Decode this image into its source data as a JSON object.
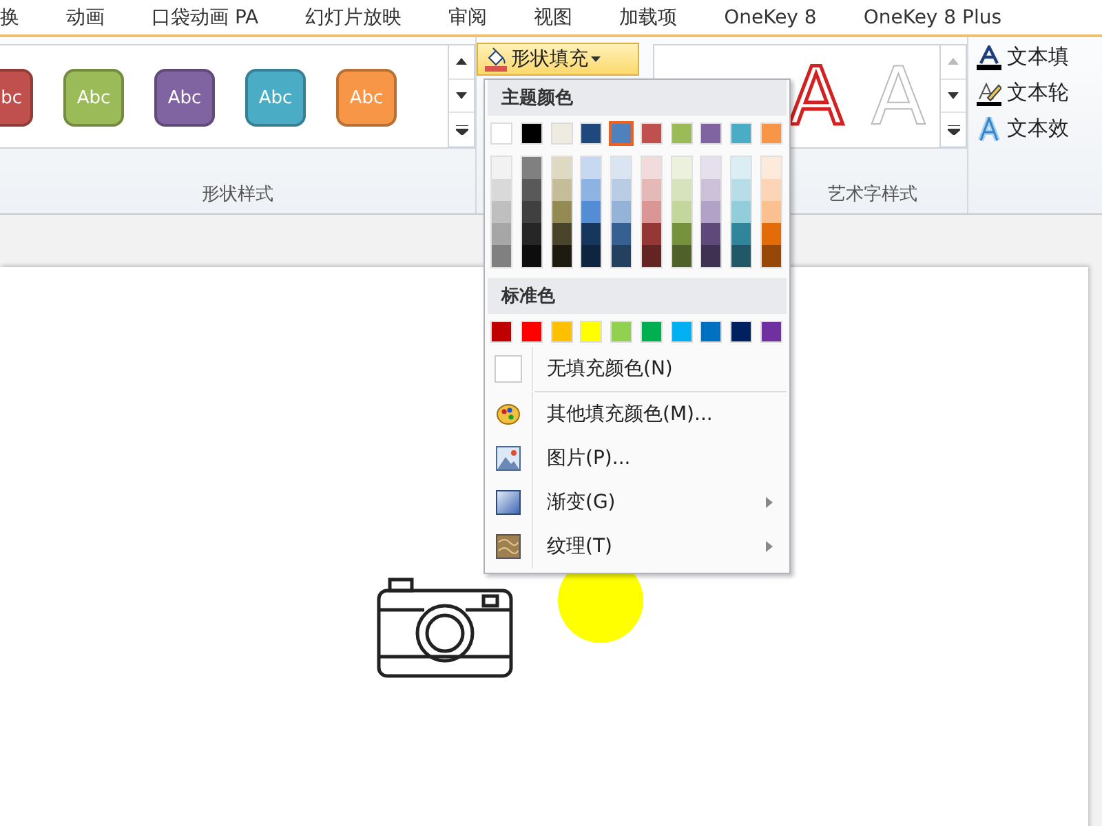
{
  "tabs": [
    {
      "label": "换",
      "selected": false
    },
    {
      "label": "动画",
      "selected": false
    },
    {
      "label": "口袋动画 PA",
      "selected": false
    },
    {
      "label": "幻灯片放映",
      "selected": false
    },
    {
      "label": "审阅",
      "selected": false
    },
    {
      "label": "视图",
      "selected": false
    },
    {
      "label": "加载项",
      "selected": false
    },
    {
      "label": "OneKey 8",
      "selected": false
    },
    {
      "label": "OneKey 8 Plus",
      "selected": false
    }
  ],
  "shape_styles": {
    "label": "形状样式",
    "swatches": [
      {
        "text": "bc",
        "color": "#c0504d"
      },
      {
        "text": "Abc",
        "color": "#9bbb59"
      },
      {
        "text": "Abc",
        "color": "#8064a2"
      },
      {
        "text": "Abc",
        "color": "#4bacc6"
      },
      {
        "text": "Abc",
        "color": "#f79646"
      }
    ]
  },
  "fill_button": {
    "label": "形状填充",
    "open": true
  },
  "wordart": {
    "label": "艺术字样式",
    "samples": [
      {
        "text": "A",
        "kind": "red"
      },
      {
        "text": "A",
        "kind": "white"
      }
    ],
    "commands": [
      {
        "label": "文本填",
        "kind": "fill"
      },
      {
        "label": "文本轮",
        "kind": "outline"
      },
      {
        "label": "文本效",
        "kind": "effect"
      }
    ]
  },
  "menu": {
    "theme_heading": "主题颜色",
    "theme_colors": [
      {
        "color": "#ffffff",
        "selected": false
      },
      {
        "color": "#000000",
        "selected": false
      },
      {
        "color": "#eeece1",
        "selected": false
      },
      {
        "color": "#1f497d",
        "selected": false
      },
      {
        "color": "#4f81bd",
        "selected": true
      },
      {
        "color": "#c0504d",
        "selected": false
      },
      {
        "color": "#9bbb59",
        "selected": false
      },
      {
        "color": "#8064a2",
        "selected": false
      },
      {
        "color": "#4bacc6",
        "selected": false
      },
      {
        "color": "#f79646",
        "selected": false
      }
    ],
    "shades": [
      [
        {
          "color": "#f2f2f2"
        },
        {
          "color": "#d9d9d9"
        },
        {
          "color": "#bfbfbf"
        },
        {
          "color": "#a6a6a6"
        },
        {
          "color": "#808080"
        }
      ],
      [
        {
          "color": "#808080"
        },
        {
          "color": "#595959"
        },
        {
          "color": "#404040"
        },
        {
          "color": "#262626"
        },
        {
          "color": "#0d0d0d"
        }
      ],
      [
        {
          "color": "#ddd9c3"
        },
        {
          "color": "#c4bd97"
        },
        {
          "color": "#948a54"
        },
        {
          "color": "#4a452a"
        },
        {
          "color": "#1d1b10"
        }
      ],
      [
        {
          "color": "#c6d9f0"
        },
        {
          "color": "#8db3e2"
        },
        {
          "color": "#548dd4"
        },
        {
          "color": "#17365d"
        },
        {
          "color": "#0f243e"
        }
      ],
      [
        {
          "color": "#dbe5f1"
        },
        {
          "color": "#b8cce4"
        },
        {
          "color": "#95b3d7"
        },
        {
          "color": "#366092"
        },
        {
          "color": "#244061"
        }
      ],
      [
        {
          "color": "#f2dcdb"
        },
        {
          "color": "#e5b9b7"
        },
        {
          "color": "#d99694"
        },
        {
          "color": "#953734"
        },
        {
          "color": "#632423"
        }
      ],
      [
        {
          "color": "#ebf1dd"
        },
        {
          "color": "#d7e3bc"
        },
        {
          "color": "#c3d69b"
        },
        {
          "color": "#76923c"
        },
        {
          "color": "#4f6128"
        }
      ],
      [
        {
          "color": "#e5e0ec"
        },
        {
          "color": "#ccc1d9"
        },
        {
          "color": "#b2a2c7"
        },
        {
          "color": "#5f497a"
        },
        {
          "color": "#3f3151"
        }
      ],
      [
        {
          "color": "#dbeef3"
        },
        {
          "color": "#b7dde8"
        },
        {
          "color": "#92cddc"
        },
        {
          "color": "#31859b"
        },
        {
          "color": "#205867"
        }
      ],
      [
        {
          "color": "#fdeada"
        },
        {
          "color": "#fbd5b5"
        },
        {
          "color": "#fac08f"
        },
        {
          "color": "#e36c09"
        },
        {
          "color": "#974806"
        }
      ]
    ],
    "standard_heading": "标准色",
    "standard_colors": [
      {
        "color": "#c00000"
      },
      {
        "color": "#ff0000"
      },
      {
        "color": "#ffc000"
      },
      {
        "color": "#ffff00"
      },
      {
        "color": "#92d050"
      },
      {
        "color": "#00b050"
      },
      {
        "color": "#00b0f0"
      },
      {
        "color": "#0070c0"
      },
      {
        "color": "#002060"
      },
      {
        "color": "#7030a0"
      }
    ],
    "items": [
      {
        "label": "无填充颜色(N)",
        "kind": "none",
        "submenu": false
      },
      {
        "label": "其他填充颜色(M)...",
        "kind": "palette",
        "submenu": false
      },
      {
        "label": "图片(P)...",
        "kind": "picture",
        "submenu": false
      },
      {
        "label": "渐变(G)",
        "kind": "gradient",
        "submenu": true
      },
      {
        "label": "纹理(T)",
        "kind": "texture",
        "submenu": true
      }
    ]
  }
}
